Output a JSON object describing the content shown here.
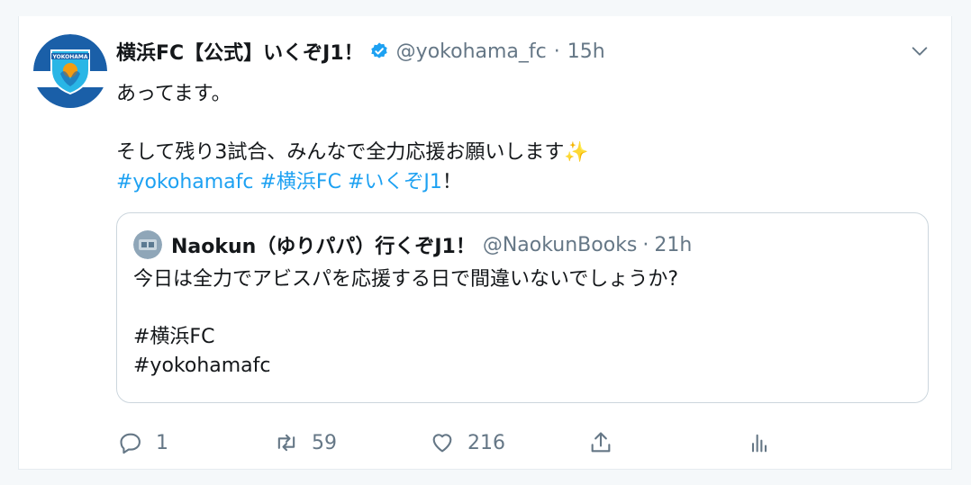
{
  "tweet": {
    "author_name": "横浜FC【公式】いくぞJ1！",
    "handle": "@yokohama_fc",
    "separator": "·",
    "time": "15h",
    "lines": [
      "あってます。",
      "",
      "そして残り3試合、みんなで全力応援お願いします✨"
    ],
    "hashtags": "#yokohamafc #横浜FC #いくぞJ1",
    "hashtags_suffix": "！",
    "avatar_text": "YOKOHAMA"
  },
  "quote": {
    "author_name": "Naokun（ゆりパパ）行くぞJ1！",
    "handle": "@NaokunBooks",
    "separator": "·",
    "time": "21h",
    "line1": "今日は全力でアビスパを応援する日で間違いないでしょうか?",
    "tag1": "#横浜FC",
    "tag2": "#yokohamafc"
  },
  "actions": {
    "reply_count": "1",
    "retweet_count": "59",
    "like_count": "216"
  },
  "icons": {
    "verified": "verified-badge-icon",
    "more": "chevron-down-icon",
    "reply": "reply-icon",
    "retweet": "retweet-icon",
    "like": "heart-icon",
    "share": "share-icon",
    "analytics": "analytics-icon"
  },
  "colors": {
    "link": "#1da1f2",
    "secondary": "#657786",
    "brand_blue": "#1a5fa8",
    "brand_cyan": "#29b6e6"
  }
}
